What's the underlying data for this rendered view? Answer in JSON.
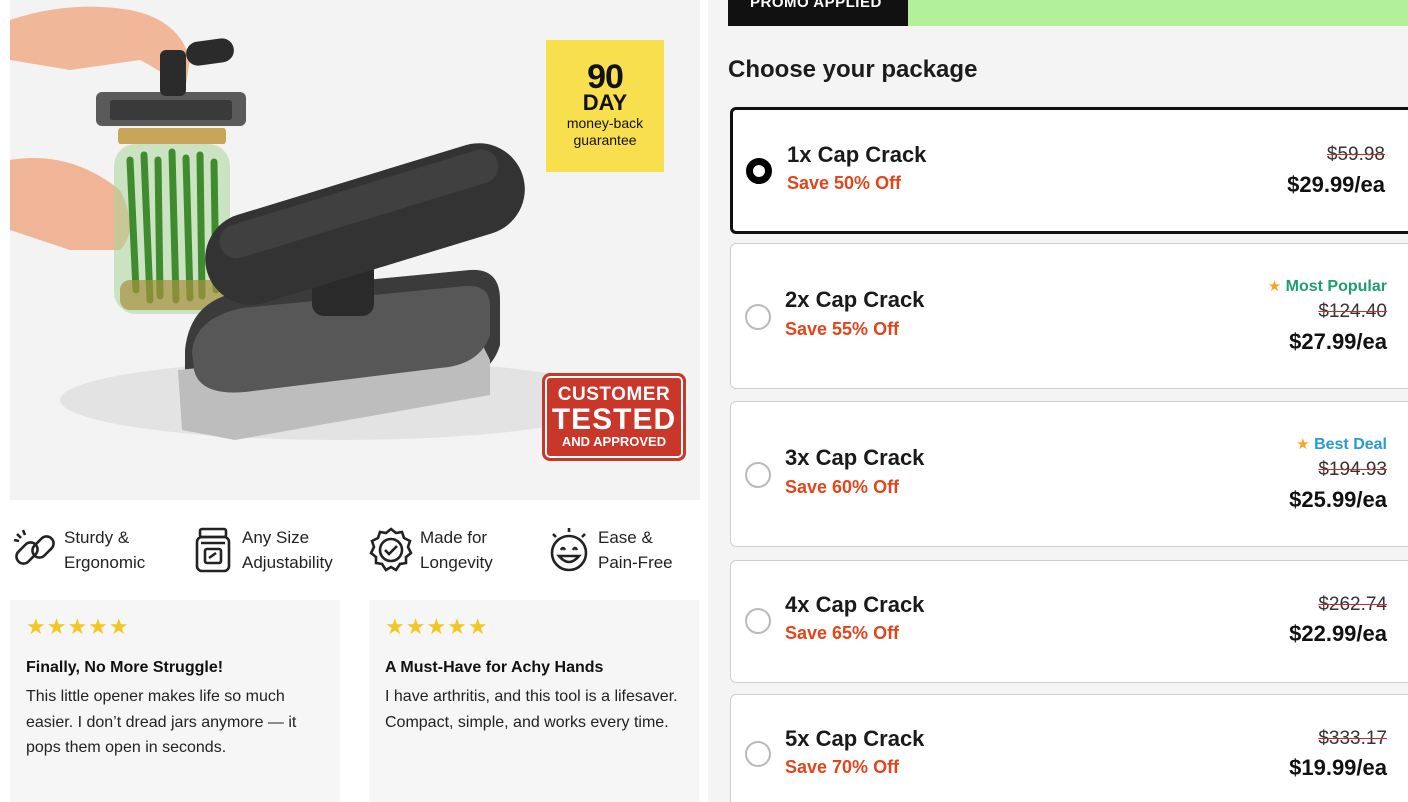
{
  "hero": {
    "badge_90": {
      "number": "90",
      "unit": "DAY",
      "line1": "money-back",
      "line2": "guarantee"
    },
    "badge_tested": {
      "line1": "CUSTOMER",
      "line2": "TESTED",
      "line3": "AND APPROVED"
    }
  },
  "features": [
    {
      "icon": "chain-link-icon",
      "line1": "Sturdy &",
      "line2": "Ergonomic"
    },
    {
      "icon": "jar-icon",
      "line1": "Any Size",
      "line2": "Adjustability"
    },
    {
      "icon": "check-seal-icon",
      "line1": "Made for",
      "line2": "Longevity"
    },
    {
      "icon": "happy-face-icon",
      "line1": "Ease &",
      "line2": "Pain-Free"
    }
  ],
  "reviews": [
    {
      "stars": "★★★★★",
      "title": "Finally, No More Struggle!",
      "body": "This little opener makes life so much easier. I don’t dread jars anymore — it pops them open in seconds."
    },
    {
      "stars": "★★★★★",
      "title": "A Must-Have for Achy Hands",
      "body": "I have arthritis, and this tool is a lifesaver. Compact, simple, and works every time."
    }
  ],
  "promo": {
    "label": "PROMO APPLIED"
  },
  "package_section": {
    "title": "Choose your package"
  },
  "packages": [
    {
      "name": "1x Cap Crack",
      "save": "Save 50% Off",
      "old_price": "$59.98",
      "price": "$29.99/ea",
      "tag": "",
      "selected": true
    },
    {
      "name": "2x Cap Crack",
      "save": "Save 55% Off",
      "old_price": "$124.40",
      "price": "$27.99/ea",
      "tag": "Most Popular",
      "tag_color": "#1e9e6e",
      "selected": false
    },
    {
      "name": "3x Cap Crack",
      "save": "Save 60% Off",
      "old_price": "$194.93",
      "price": "$25.99/ea",
      "tag": "Best Deal",
      "tag_color": "#2a9bd1",
      "selected": false
    },
    {
      "name": "4x Cap Crack",
      "save": "Save 65% Off",
      "old_price": "$262.74",
      "price": "$22.99/ea",
      "tag": "",
      "selected": false
    },
    {
      "name": "5x Cap Crack",
      "save": "Save 70% Off",
      "old_price": "$333.17",
      "price": "$19.99/ea",
      "tag": "",
      "selected": false
    }
  ],
  "colors": {
    "save_orange": "#e0461c",
    "badge_yellow": "#f7df4d",
    "badge_red": "#c9362a",
    "promo_green": "#b3f09a",
    "star_gold": "#f3c623"
  }
}
